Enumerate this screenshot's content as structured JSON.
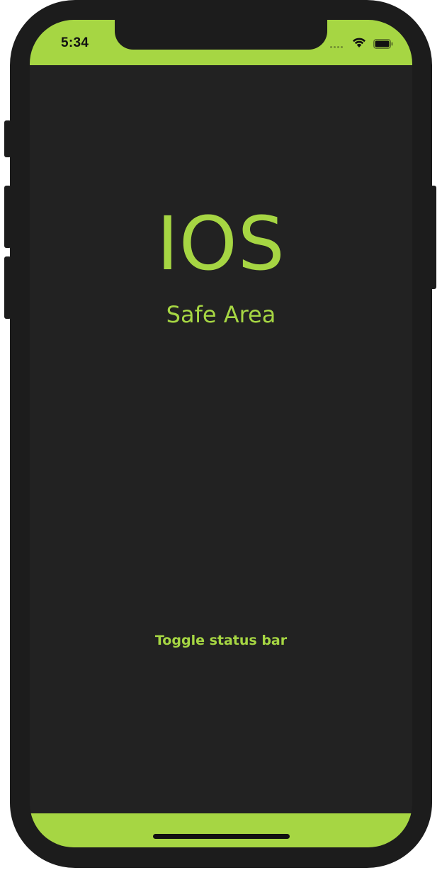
{
  "colors": {
    "accent": "#a6d643",
    "background": "#222222",
    "device_frame": "#1c1c1c",
    "status_text": "#111111"
  },
  "status_bar": {
    "time": "5:34",
    "icons": [
      "cellular-dots-icon",
      "wifi-icon",
      "battery-icon"
    ]
  },
  "main": {
    "title": "IOS",
    "subtitle": "Safe Area",
    "toggle_button_label": "Toggle status bar"
  },
  "home_indicator": {
    "icon": "home-indicator"
  }
}
